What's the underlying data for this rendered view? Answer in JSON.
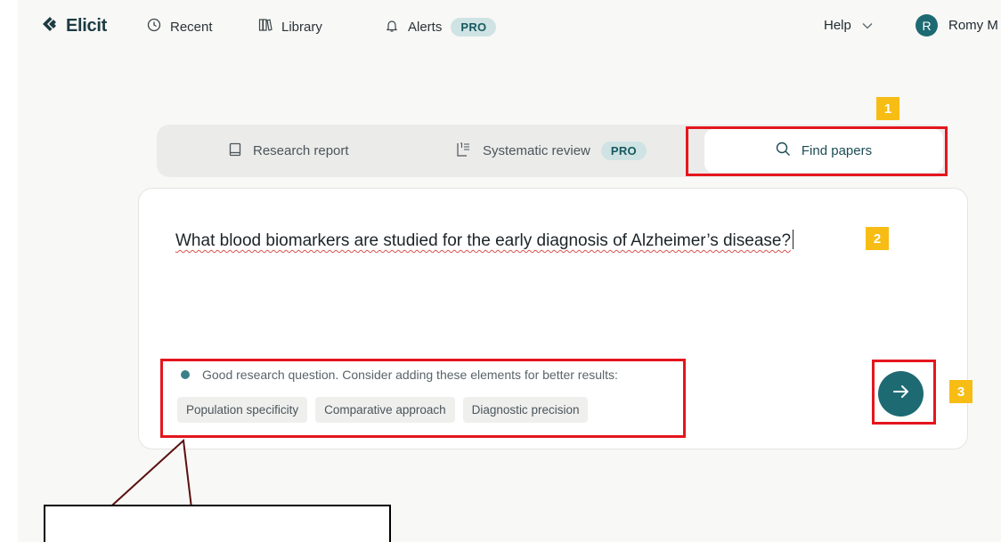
{
  "nav": {
    "brand": "Elicit",
    "recent": "Recent",
    "library": "Library",
    "alerts": "Alerts",
    "alerts_badge": "PRO",
    "help": "Help",
    "user_initial": "R",
    "user_name": "Romy M"
  },
  "tabs": [
    {
      "label": "Research report",
      "icon": "notebook-icon"
    },
    {
      "label": "Systematic review",
      "icon": "checklist-icon",
      "badge": "PRO"
    },
    {
      "label": "Find papers",
      "icon": "search-icon",
      "active": true
    }
  ],
  "query": {
    "text": "What blood biomarkers are studied for the early diagnosis of Alzheimer’s disease?"
  },
  "feedback": {
    "message": "Good research question. Consider adding these elements for better results:",
    "chips": [
      "Population specificity",
      "Comparative approach",
      "Diagnostic precision"
    ]
  },
  "submit": {
    "icon": "arrow-right-icon"
  },
  "markers": [
    "1",
    "2",
    "3"
  ],
  "colors": {
    "accent": "#1e6a73",
    "badge_bg": "#cfe3e4",
    "highlight": "#e4161d",
    "marker": "#f7bd14"
  }
}
